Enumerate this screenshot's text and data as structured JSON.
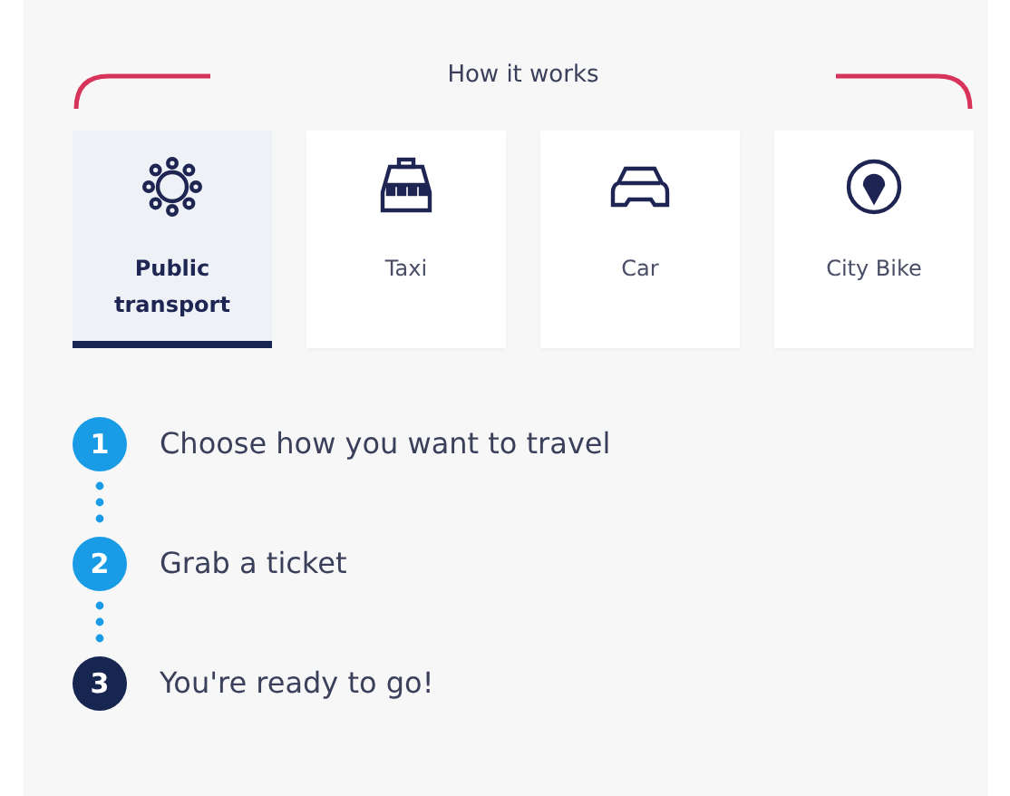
{
  "title": "How it works",
  "tabs": [
    {
      "label": "Public transport",
      "selected": true
    },
    {
      "label": "Taxi",
      "selected": false
    },
    {
      "label": "Car",
      "selected": false
    },
    {
      "label": "City Bike",
      "selected": false
    }
  ],
  "steps": [
    {
      "number": "1",
      "text": "Choose how you want to travel",
      "color": "#1a9be6"
    },
    {
      "number": "2",
      "text": "Grab a ticket",
      "color": "#1a9be6"
    },
    {
      "number": "3",
      "text": "You're ready to go!",
      "color": "#172650"
    }
  ]
}
